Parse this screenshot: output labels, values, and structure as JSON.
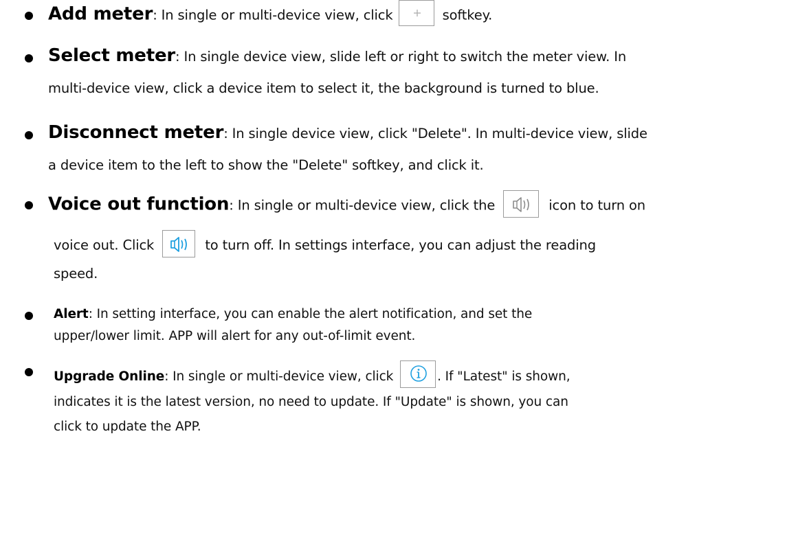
{
  "items": [
    {
      "term": "Add meter",
      "lines": [
        {
          "before": ": In single or multi-device view, click ",
          "after": " softkey."
        }
      ],
      "icon": "plus-icon"
    },
    {
      "term": "Select meter",
      "lines": [
        {
          "text": ": In single device view, slide left or right to switch the meter view. In"
        },
        {
          "text": "multi-device view, click a device item to select it, the background is turned to blue."
        }
      ]
    },
    {
      "term": "Disconnect meter",
      "lines": [
        {
          "text": ": In single device view, click \"Delete\". In multi-device view, slide"
        },
        {
          "text": "a device item to the left to show the \"Delete\" softkey, and click it."
        }
      ]
    },
    {
      "term": "Voice out function",
      "lines": [
        {
          "before": ": In single or multi-device view, click the ",
          "after": " icon to turn on"
        },
        {
          "before": "voice out. Click ",
          "after": " to turn off. In settings interface, you can adjust the reading"
        },
        {
          "text": "speed."
        }
      ],
      "icons": [
        "speaker-off-icon",
        "speaker-on-icon"
      ]
    },
    {
      "term": "Alert",
      "lines": [
        {
          "text": ": In setting interface, you can enable the alert notification, and set the"
        },
        {
          "text": "upper/lower limit. APP will alert for any out-of-limit event."
        }
      ]
    },
    {
      "term": "Upgrade Online",
      "lines": [
        {
          "before": ": In single or multi-device view, click ",
          "after": ". If \"Latest\" is shown,"
        },
        {
          "text": "indicates it is the latest version, no need to update. If \"Update\" is shown, you can"
        },
        {
          "text": "click to update the APP."
        }
      ],
      "icon": "info-icon"
    }
  ],
  "colors": {
    "text": "#111111",
    "icon_gray": "#b0b0b0",
    "icon_blue": "#1fa0e0"
  }
}
